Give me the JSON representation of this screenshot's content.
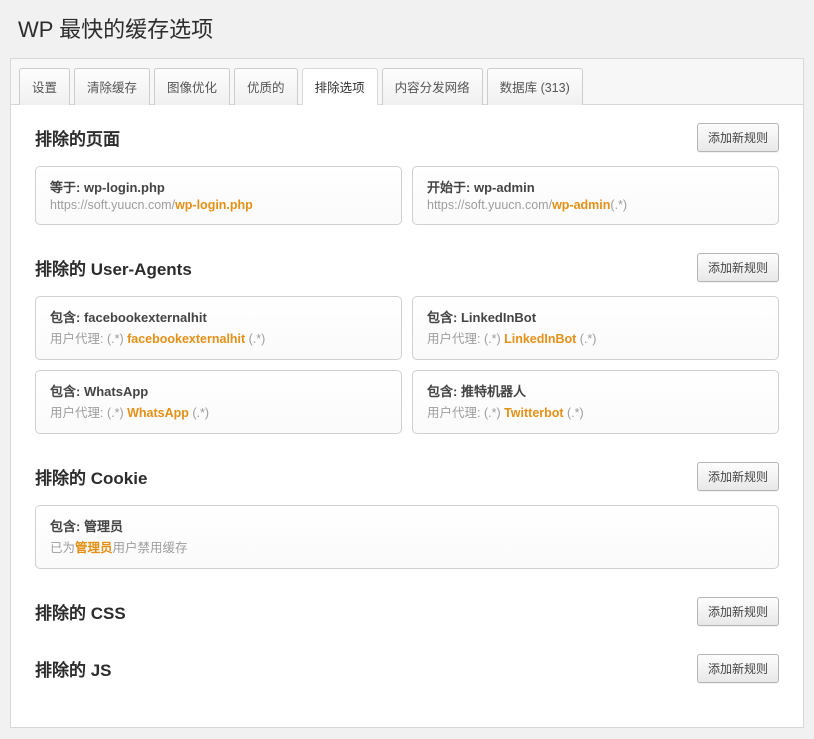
{
  "pageTitle": "WP 最快的缓存选项",
  "tabs": [
    {
      "label": "设置"
    },
    {
      "label": "清除缓存"
    },
    {
      "label": "图像优化"
    },
    {
      "label": "优质的"
    },
    {
      "label": "排除选项",
      "active": true
    },
    {
      "label": "内容分发网络"
    },
    {
      "label": "数据库 (313)"
    }
  ],
  "addButtonLabel": "添加新规则",
  "sections": {
    "pages": {
      "title": "排除的页面",
      "rules": [
        {
          "prefix": "等于:",
          "value": "wp-login.php",
          "detailPre": "https://soft.yuucn.com/",
          "detailHl": "wp-login.php",
          "detailPost": ""
        },
        {
          "prefix": "开始于:",
          "value": "wp-admin",
          "detailPre": "https://soft.yuucn.com/",
          "detailHl": "wp-admin",
          "detailPost": "(.*)"
        }
      ]
    },
    "userAgents": {
      "title": "排除的 User-Agents",
      "rules": [
        {
          "prefix": "包含:",
          "value": "facebookexternalhit",
          "detailPre": "用户代理: (.*) ",
          "detailHl": "facebookexternalhit",
          "detailPost": " (.*)"
        },
        {
          "prefix": "包含:",
          "value": "LinkedInBot",
          "detailPre": "用户代理: (.*) ",
          "detailHl": "LinkedInBot",
          "detailPost": " (.*)"
        },
        {
          "prefix": "包含:",
          "value": "WhatsApp",
          "detailPre": "用户代理: (.*) ",
          "detailHl": "WhatsApp",
          "detailPost": " (.*)"
        },
        {
          "prefix": "包含:",
          "value": "推特机器人",
          "detailPre": "用户代理: (.*) ",
          "detailHl": "Twitterbot",
          "detailPost": " (.*)"
        }
      ]
    },
    "cookies": {
      "title": "排除的 Cookie",
      "rules": [
        {
          "prefix": "包含:",
          "value": "管理员",
          "detailPre": "已为",
          "detailHl": "管理员",
          "detailPost": "用户禁用缓存",
          "full": true
        }
      ]
    },
    "css": {
      "title": "排除的 CSS"
    },
    "js": {
      "title": "排除的 JS"
    }
  }
}
